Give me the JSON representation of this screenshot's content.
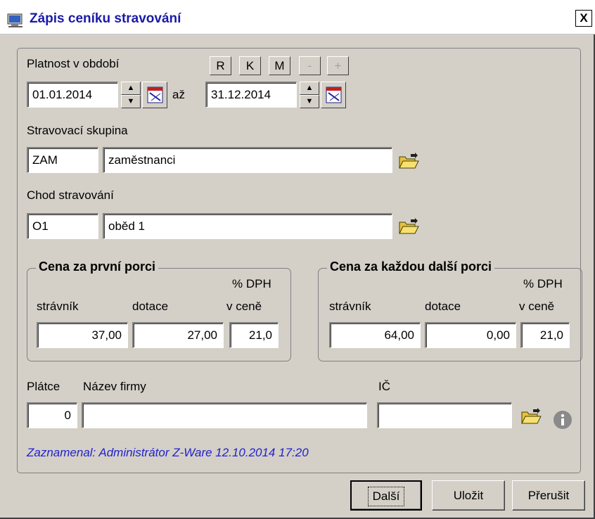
{
  "window": {
    "title": "Zápis ceníku stravování",
    "close_label": "X"
  },
  "validity": {
    "label": "Platnost v období",
    "from": "01.01.2014",
    "separator": "až",
    "to": "31.12.2014",
    "quick_buttons": [
      "R",
      "K",
      "M",
      "-",
      "+"
    ]
  },
  "group": {
    "label": "Stravovací skupina",
    "code": "ZAM",
    "name": "zaměstnanci"
  },
  "course": {
    "label": "Chod stravování",
    "code": "O1",
    "name": "oběd 1"
  },
  "first_portion": {
    "title": "Cena za první porci",
    "col_diner": "strávník",
    "col_subsidy": "dotace",
    "col_vat_top": "% DPH",
    "col_vat_bottom": "v ceně",
    "diner": "37,00",
    "subsidy": "27,00",
    "vat": "21,0"
  },
  "next_portion": {
    "title": "Cena za každou další porci",
    "col_diner": "strávník",
    "col_subsidy": "dotace",
    "col_vat_top": "% DPH",
    "col_vat_bottom": "v ceně",
    "diner": "64,00",
    "subsidy": "0,00",
    "vat": "21,0"
  },
  "payer": {
    "label_payer": "Plátce",
    "label_company": "Název firmy",
    "label_ic": "IČ",
    "payer": "0",
    "company": "",
    "ic": ""
  },
  "recorded": "Zaznamenal: Administrátor Z-Ware 12.10.2014 17:20",
  "buttons": {
    "next": "Další",
    "save": "Uložit",
    "cancel": "Přerušit"
  },
  "colors": {
    "face": "#d4d0c8",
    "title_text": "#1a1aa8",
    "info_text": "#2222cc"
  }
}
